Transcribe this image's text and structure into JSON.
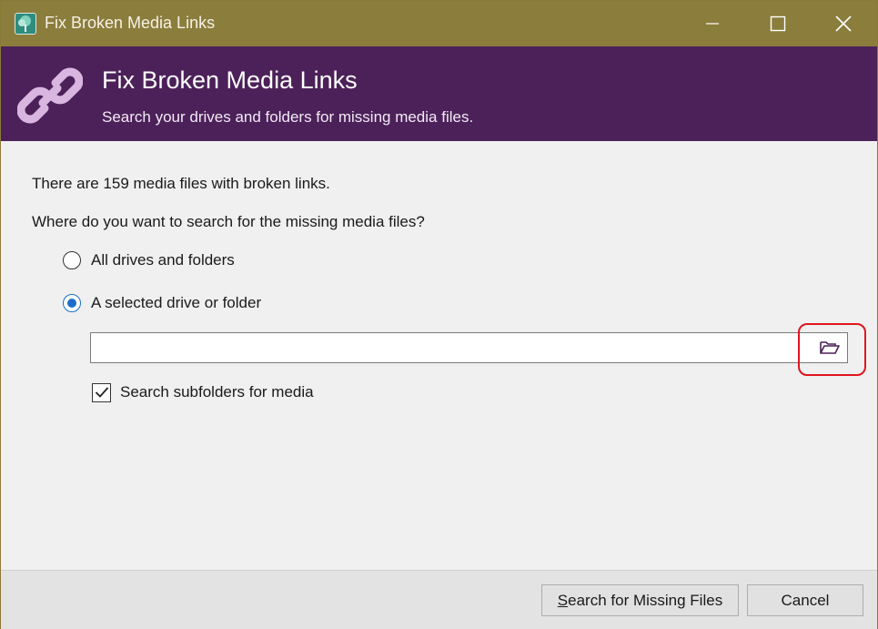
{
  "window": {
    "title": "Fix Broken Media Links",
    "controls": {
      "minimize": "minimize-icon",
      "maximize": "maximize-icon",
      "close": "close-icon"
    }
  },
  "banner": {
    "title": "Fix Broken Media Links",
    "subtitle": "Search your drives and folders for missing media files.",
    "icon": "chain-link-icon"
  },
  "content": {
    "status": "There are 159 media files with broken links.",
    "question": "Where do you want to search for the missing media files?",
    "options": [
      {
        "label": "All drives and folders",
        "selected": false
      },
      {
        "label": "A selected drive or folder",
        "selected": true
      }
    ],
    "folder_path": {
      "value": "",
      "placeholder": ""
    },
    "browse_icon": "folder-open-icon",
    "subfolders": {
      "label": "Search subfolders for media",
      "checked": true
    }
  },
  "footer": {
    "search_button": {
      "mnemonic": "S",
      "rest": "earch for Missing Files"
    },
    "cancel_button": "Cancel"
  },
  "colors": {
    "titlebar": "#8b7d3c",
    "banner": "#4c2159",
    "radio_accent": "#1d6fc9",
    "highlight": "#e0141e"
  }
}
